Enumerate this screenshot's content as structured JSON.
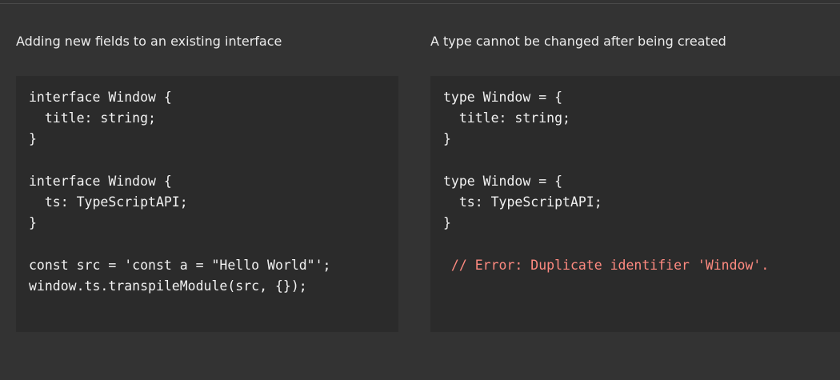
{
  "left": {
    "title": "Adding new fields to an existing interface",
    "code_lines": [
      "interface Window {",
      "  title: string;",
      "}",
      "",
      "interface Window {",
      "  ts: TypeScriptAPI;",
      "}",
      "",
      "const src = 'const a = \"Hello World\"';",
      "window.ts.transpileModule(src, {});"
    ]
  },
  "right": {
    "title": "A type cannot be changed after being created",
    "code_lines": [
      "type Window = {",
      "  title: string;",
      "}",
      "",
      "type Window = {",
      "  ts: TypeScriptAPI;",
      "}",
      "",
      " // Error: Duplicate identifier 'Window'."
    ],
    "error_line_index": 8
  },
  "colors": {
    "page_background": "#333333",
    "code_background": "#2b2b2b",
    "code_text": "#f2f2f2",
    "error_text": "#ff8a80"
  }
}
